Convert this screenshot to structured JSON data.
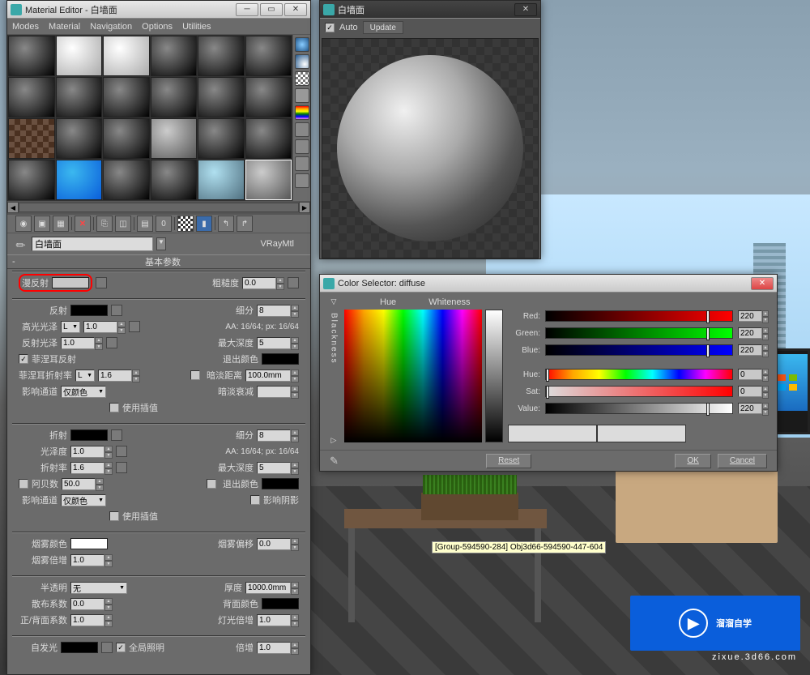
{
  "mat_editor": {
    "title": "Material Editor - 白墙面",
    "menu": [
      "Modes",
      "Material",
      "Navigation",
      "Options",
      "Utilities"
    ],
    "mat_name": "白墙面",
    "mat_type": "VRayMtl",
    "rollout_basic": "基本参数",
    "params": {
      "diffuse_label": "漫反射",
      "roughness_label": "粗糙度",
      "roughness_val": "0.0",
      "reflect_label": "反射",
      "subdiv_label": "细分",
      "subdiv_val": "8",
      "hilight_label": "高光光泽",
      "hilight_val": "1.0",
      "aa_text": "AA: 16/64; px: 16/64",
      "refl_gloss_label": "反射光泽",
      "refl_gloss_val": "1.0",
      "max_depth_label": "最大深度",
      "max_depth_val": "5",
      "fresnel_label": "菲涅耳反射",
      "exit_color_label": "退出颜色",
      "fresnel_ior_label": "菲涅耳折射率",
      "fresnel_ior_val": "1.6",
      "dim_dist_label": "暗淡距离",
      "dim_dist_val": "100.0mm",
      "affect_chan_label": "影响通道",
      "affect_chan_val": "仅颜色",
      "dim_falloff_label": "暗淡衰减",
      "use_interp_label": "使用插值",
      "refract_label": "折射",
      "refract_subdiv_val": "8",
      "glossiness_label": "光泽度",
      "glossiness_val": "1.0",
      "ior_label": "折射率",
      "ior_val": "1.6",
      "refr_max_depth_val": "5",
      "abbe_label": "阿贝数",
      "abbe_val": "50.0",
      "refr_exit_label": "退出颜色",
      "affect_shadow_label": "影响阴影",
      "use_interp2_label": "使用插值",
      "fog_color_label": "烟雾颜色",
      "fog_bias_label": "烟雾偏移",
      "fog_bias_val": "0.0",
      "fog_mult_label": "烟雾倍增",
      "fog_mult_val": "1.0",
      "translucent_label": "半透明",
      "translucent_val": "无",
      "thickness_label": "厚度",
      "thickness_val": "1000.0mm",
      "scatter_label": "散布系数",
      "scatter_val": "0.0",
      "back_color_label": "背面颜色",
      "fb_coeff_label": "正/背面系数",
      "fb_coeff_val": "1.0",
      "light_mult_label": "灯光倍增",
      "light_mult_val": "1.0",
      "selfillum_label": "自发光",
      "gi_label": "全局照明",
      "mult_label": "倍增",
      "mult_val": "1.0",
      "lock_L": "L"
    }
  },
  "preview": {
    "title": "白墙面",
    "auto": "Auto",
    "update": "Update"
  },
  "color_selector": {
    "title": "Color Selector: diffuse",
    "hue": "Hue",
    "whiteness": "Whiteness",
    "blackness": "Blackness",
    "red": "Red:",
    "green": "Green:",
    "blue": "Blue:",
    "hue_l": "Hue:",
    "sat": "Sat:",
    "value": "Value:",
    "red_v": "220",
    "green_v": "220",
    "blue_v": "220",
    "hue_v": "0",
    "sat_v": "0",
    "value_v": "220",
    "reset": "Reset",
    "ok": "OK",
    "cancel": "Cancel"
  },
  "scene": {
    "tooltip": "[Group-594590-284] Obj3d66-594590-447-604"
  },
  "watermark": {
    "text": "溜溜自学",
    "sub": "zixue.3d66.com"
  }
}
